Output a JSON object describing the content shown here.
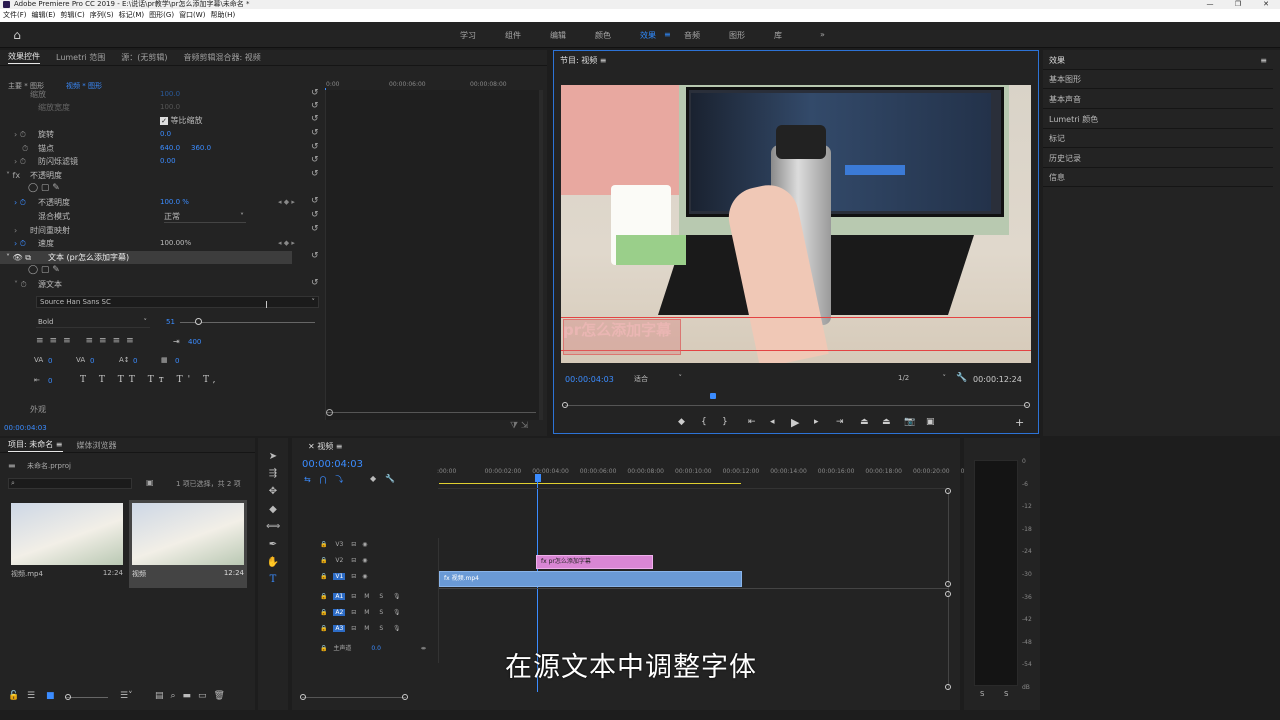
{
  "titlebar": {
    "title": "Adobe Premiere Pro CC 2019 - E:\\说话\\pr教学\\pr怎么添加字幕\\未命名 *",
    "min": "—",
    "max": "❐",
    "close": "✕"
  },
  "menu": [
    "文件(F)",
    "编辑(E)",
    "剪辑(C)",
    "序列(S)",
    "标记(M)",
    "图形(G)",
    "窗口(W)",
    "帮助(H)"
  ],
  "workspaces": {
    "items": [
      "学习",
      "组件",
      "编辑",
      "颜色",
      "效果",
      "音频",
      "图形",
      "库"
    ],
    "active": "效果",
    "more": "»"
  },
  "effect_controls": {
    "tabs": [
      "效果控件",
      "Lumetri 范围",
      "源：(无剪辑)",
      "音频剪辑混合器: 视频"
    ],
    "master": "主要 * 图形",
    "clip": "视频 * 图形",
    "ruler": [
      "0:00",
      "00:00:06:00",
      "00:00:08:00"
    ],
    "rows": {
      "scale": "缩放",
      "scale_val": "100.0",
      "scale_w": "缩放宽度",
      "scale_w_val": "100.0",
      "uniform": "等比缩放",
      "rotation": "旋转",
      "rotation_val": "0.0",
      "anchor": "锚点",
      "anchor_x": "640.0",
      "anchor_y": "360.0",
      "flicker": "防闪烁滤镜",
      "flicker_val": "0.00",
      "opacity_group": "不透明度",
      "opacity": "不透明度",
      "opacity_val": "100.0 %",
      "blend": "混合模式",
      "blend_val": "正常",
      "timeremap": "时间重映射",
      "speed": "速度",
      "speed_val": "100.00%",
      "text_layer": "文本 (pr怎么添加字幕)",
      "source_text": "源文本",
      "font": "Source Han Sans SC",
      "style": "Bold",
      "size": "51",
      "tracking_val": "400",
      "kern_val": "0",
      "track_val": "0",
      "lead_val": "0",
      "baseline_val": "0",
      "tsume_val": "0",
      "appearance": "外观"
    },
    "timecode": "00:00:04:03"
  },
  "program": {
    "title": "节目: 视频",
    "overlay_text": "pr怎么添加字幕",
    "timecode": "00:00:04:03",
    "fit": "适合",
    "resolution": "1/2",
    "duration": "00:00:12:24",
    "playhead_fraction": 0.32
  },
  "right_panel": [
    "效果",
    "基本图形",
    "基本声音",
    "Lumetri 颜色",
    "标记",
    "历史记录",
    "信息"
  ],
  "project": {
    "tabs": [
      "项目: 未命名",
      "媒体浏览器"
    ],
    "file": "未命名.prproj",
    "selection": "1 项已选择，共 2 项",
    "items": [
      {
        "name": "视频.mp4",
        "duration": "12:24"
      },
      {
        "name": "视频",
        "duration": "12:24"
      }
    ]
  },
  "timeline": {
    "tab": "视频",
    "timecode": "00:00:04:03",
    "ruler": [
      ":00:00",
      "00:00:02:00",
      "00:00:04:00",
      "00:00:06:00",
      "00:00:08:00",
      "00:00:10:00",
      "00:00:12:00",
      "00:00:14:00",
      "00:00:16:00",
      "00:00:18:00",
      "00:00:20:00",
      "00"
    ],
    "video_tracks": [
      "V3",
      "V2",
      "V1"
    ],
    "audio_tracks": [
      "A1",
      "A2",
      "A3"
    ],
    "master": "主声道",
    "master_val": "0.0",
    "clip_v2": "pr怎么添加字幕",
    "clip_v1": "视频.mp4"
  },
  "meter": {
    "labels": [
      "0",
      "-6",
      "-12",
      "-18",
      "-24",
      "-30",
      "-36",
      "-42",
      "-48",
      "-54",
      "dB"
    ],
    "solo": [
      "S",
      "S"
    ]
  },
  "caption": "在源文本中调整字体"
}
